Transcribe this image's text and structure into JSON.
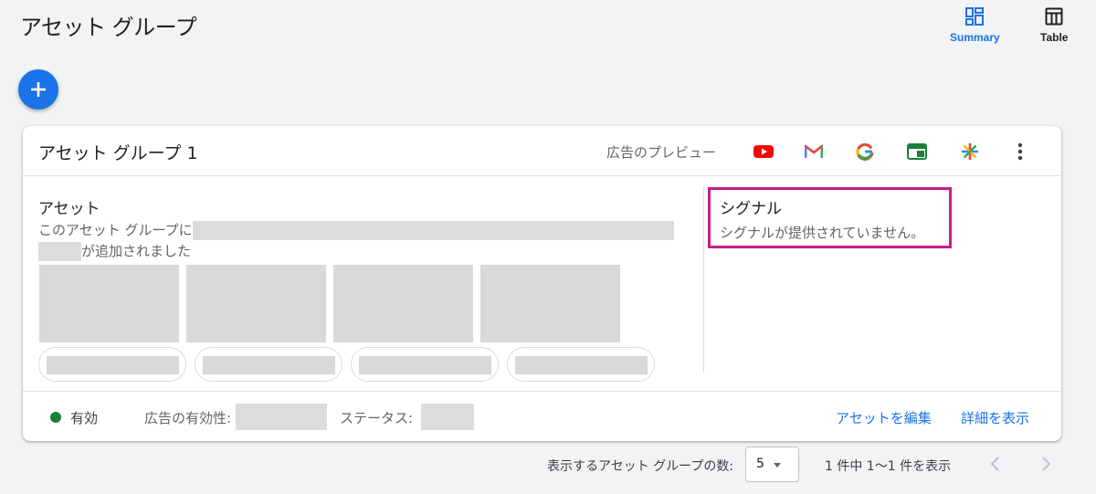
{
  "page": {
    "title": "アセット グループ",
    "views": [
      {
        "label": "Summary",
        "icon": "summary-dashboard-icon",
        "active": true
      },
      {
        "label": "Table",
        "icon": "table-icon",
        "active": false
      }
    ],
    "add_icon": "plus-icon"
  },
  "card": {
    "title": "アセット グループ 1",
    "preview_label": "広告のプレビュー",
    "preview_icons": [
      "youtube-icon",
      "gmail-icon",
      "google-icon",
      "display-icon",
      "discover-icon"
    ],
    "more_icon": "more-vert-icon",
    "assets": {
      "title": "アセット",
      "desc_prefix": "このアセット グループに",
      "desc_suffix": "が追加されました"
    },
    "signals": {
      "title": "シグナル",
      "empty_text": "シグナルが提供されていません。"
    },
    "footer": {
      "status": "有効",
      "ad_strength_label": "広告の有効性:",
      "status_label": "ステータス:",
      "edit_link": "アセットを編集",
      "details_link": "詳細を表示"
    }
  },
  "pagination": {
    "label": "表示するアセット グループの数:",
    "page_size": "5",
    "range": "1 件中 1～1 件を表示"
  },
  "colors": {
    "accent": "#1a73e8",
    "status_green": "#188038",
    "highlight_magenta": "#cc1a8e"
  }
}
